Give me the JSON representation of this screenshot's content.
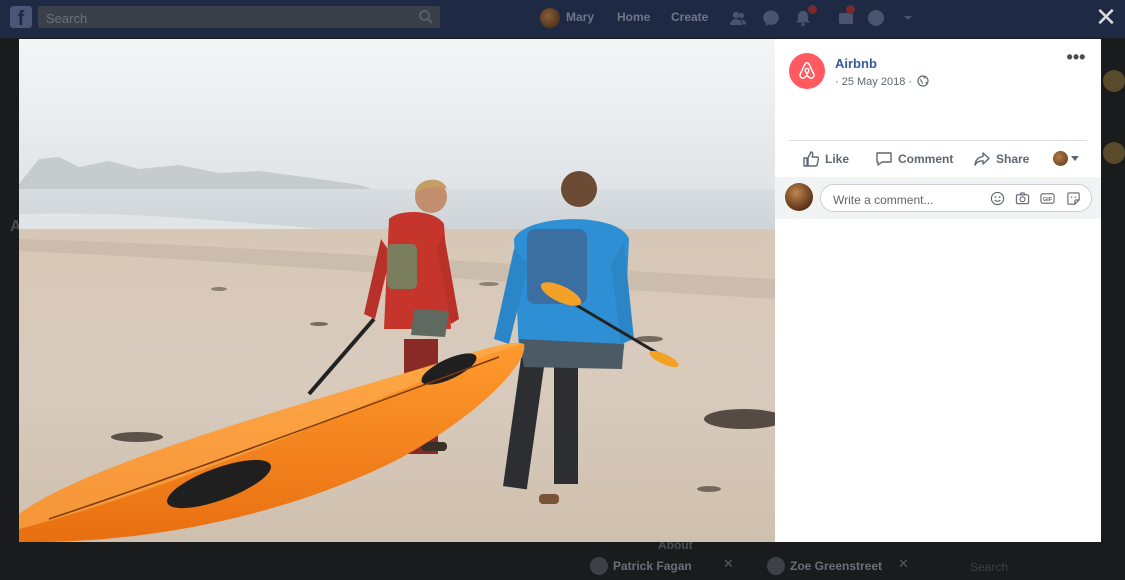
{
  "header": {
    "search_placeholder": "Search",
    "profile_name": "Mary",
    "nav_home": "Home",
    "nav_create": "Create",
    "notification_badge": "1",
    "close_symbol": "✕"
  },
  "post": {
    "page_name": "Airbnb",
    "date": "· 25 May 2018 ·",
    "privacy_icon": "globe-icon",
    "more_symbol": "•••",
    "brand_color": "#ff5a5f",
    "actions": {
      "like": "Like",
      "comment": "Comment",
      "share": "Share"
    },
    "comment_placeholder": "Write a comment...",
    "comment_icons": [
      "emoji-icon",
      "camera-icon",
      "gif-icon",
      "sticker-icon"
    ]
  },
  "background": {
    "about_label": "About",
    "chat_tabs": [
      "Patrick Fagan",
      "Zoe Greenstreet"
    ],
    "chat_search": "Search"
  },
  "colors": {
    "link_blue": "#365899",
    "secondary_text": "#606770"
  }
}
